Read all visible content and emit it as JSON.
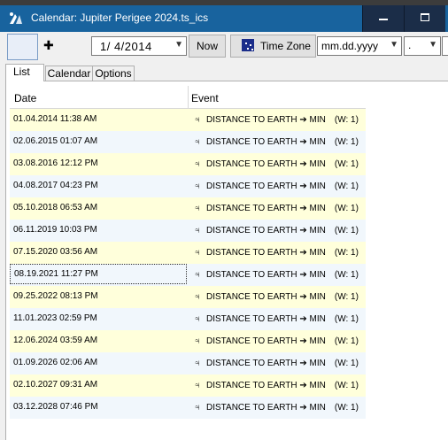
{
  "window": {
    "title": "Calendar: Jupiter Perigee 2024.ts_ics",
    "minimize_icon": "minimize-icon",
    "maximize_icon": "maximize-icon"
  },
  "toolbar": {
    "plus_symbol": "✚",
    "date_value": "1/ 4/2014",
    "now_label": "Now",
    "timezone_label": "Time Zone",
    "date_format": "mm.dd.yyyy",
    "separator": "."
  },
  "tabs": [
    {
      "label": "List"
    },
    {
      "label": "Calendar"
    },
    {
      "label": "Options"
    }
  ],
  "table": {
    "columns": [
      "Date",
      "Event"
    ],
    "rows": [
      {
        "date": "01.04.2014 11:38 AM",
        "symbol": "♃",
        "event": "DISTANCE TO EARTH ➔ MIN",
        "weight": "(W: 1)"
      },
      {
        "date": "02.06.2015 01:07 AM",
        "symbol": "♃",
        "event": "DISTANCE TO EARTH ➔ MIN",
        "weight": "(W: 1)"
      },
      {
        "date": "03.08.2016 12:12 PM",
        "symbol": "♃",
        "event": "DISTANCE TO EARTH ➔ MIN",
        "weight": "(W: 1)"
      },
      {
        "date": "04.08.2017 04:23 PM",
        "symbol": "♃",
        "event": "DISTANCE TO EARTH ➔ MIN",
        "weight": "(W: 1)"
      },
      {
        "date": "05.10.2018 06:53 AM",
        "symbol": "♃",
        "event": "DISTANCE TO EARTH ➔ MIN",
        "weight": "(W: 1)"
      },
      {
        "date": "06.11.2019 10:03 PM",
        "symbol": "♃",
        "event": "DISTANCE TO EARTH ➔ MIN",
        "weight": "(W: 1)"
      },
      {
        "date": "07.15.2020 03:56 AM",
        "symbol": "♃",
        "event": "DISTANCE TO EARTH ➔ MIN",
        "weight": "(W: 1)"
      },
      {
        "date": "08.19.2021 11:27 PM",
        "symbol": "♃",
        "event": "DISTANCE TO EARTH ➔ MIN",
        "weight": "(W: 1)"
      },
      {
        "date": "09.25.2022 08:13 PM",
        "symbol": "♃",
        "event": "DISTANCE TO EARTH ➔ MIN",
        "weight": "(W: 1)"
      },
      {
        "date": "11.01.2023 02:59 PM",
        "symbol": "♃",
        "event": "DISTANCE TO EARTH ➔ MIN",
        "weight": "(W: 1)"
      },
      {
        "date": "12.06.2024 03:59 AM",
        "symbol": "♃",
        "event": "DISTANCE TO EARTH ➔ MIN",
        "weight": "(W: 1)"
      },
      {
        "date": "01.09.2026 02:06 AM",
        "symbol": "♃",
        "event": "DISTANCE TO EARTH ➔ MIN",
        "weight": "(W: 1)"
      },
      {
        "date": "02.10.2027 09:31 AM",
        "symbol": "♃",
        "event": "DISTANCE TO EARTH ➔ MIN",
        "weight": "(W: 1)"
      },
      {
        "date": "03.12.2028 07:46 PM",
        "symbol": "♃",
        "event": "DISTANCE TO EARTH ➔ MIN",
        "weight": "(W: 1)"
      }
    ]
  },
  "colors": {
    "titlebar": "#18639e",
    "row_odd": "#ffffdb",
    "row_even": "#f1f7fc"
  }
}
